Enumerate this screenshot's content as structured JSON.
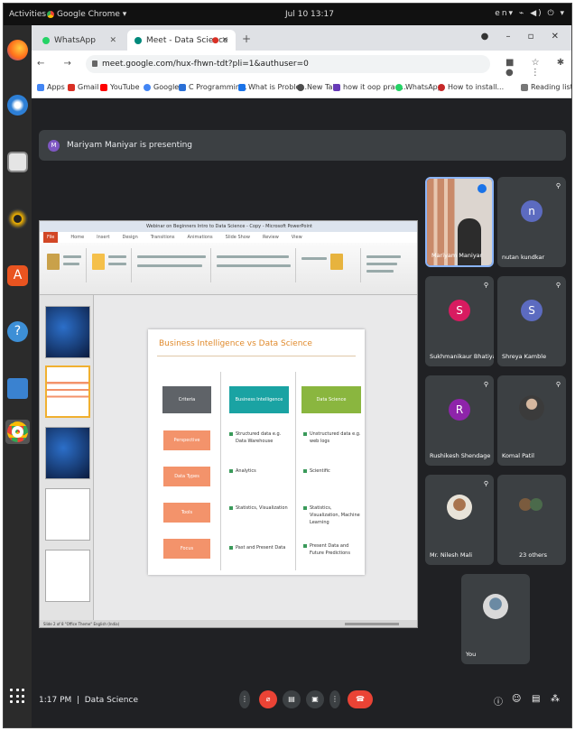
{
  "os": {
    "activities": "Activities",
    "app_name": "Google Chrome ▾",
    "clock": "Jul 10 13:17",
    "status_icons": "en▾  ⌁ ◀) ⏻ ▾"
  },
  "chrome": {
    "tabs": [
      {
        "label": "WhatsApp",
        "favicon_color": "#25d366"
      },
      {
        "label": "Meet - Data Science",
        "favicon_color": "#00897b"
      }
    ],
    "url": "meet.google.com/hux-fhwn-tdt?pli=1&authuser=0",
    "bookmarks": [
      {
        "label": "Apps",
        "color": "#4285f4"
      },
      {
        "label": "Gmail",
        "color": "#d93025"
      },
      {
        "label": "YouTube",
        "color": "#ff0000"
      },
      {
        "label": "Google",
        "color": "#4285f4"
      },
      {
        "label": "C Programmin...",
        "color": "#2a6fd6"
      },
      {
        "label": "What is Proble...",
        "color": "#1a73e8"
      },
      {
        "label": "New Tab",
        "color": "#4d4d4d"
      },
      {
        "label": "how it oop prac...",
        "color": "#673ab7"
      },
      {
        "label": "WhatsApp",
        "color": "#25d366"
      },
      {
        "label": "How to install...",
        "color": "#c62828"
      }
    ],
    "reading_list": "Reading list"
  },
  "meet": {
    "presenting_text": "Mariyam Maniyar is presenting",
    "presenting_avatar": "M",
    "meeting_time": "1:17 PM",
    "meeting_name": "Data Science",
    "participants": [
      {
        "name": "Mariyam Maniyar",
        "type": "video"
      },
      {
        "name": "nutan kundkar",
        "initial": "n",
        "color": "#5c6bc0"
      },
      {
        "name": "Sukhmanikaur Bhatiya",
        "initial": "S",
        "color": "#d81b60"
      },
      {
        "name": "Shreya Kamble",
        "initial": "S",
        "color": "#5c6bc0"
      },
      {
        "name": "Rushikesh Shendage",
        "initial": "R",
        "color": "#8e24aa"
      },
      {
        "name": "Komal Patil",
        "type": "photo"
      },
      {
        "name": "Mr. Nilesh Mali",
        "type": "photo"
      },
      {
        "name": "23 others",
        "type": "others"
      },
      {
        "name": "You",
        "type": "photo"
      }
    ]
  },
  "presentation": {
    "window_title": "Webinar on Beginners Intro to Data Science - Copy - Microsoft PowerPoint",
    "ribbon_tabs": [
      "File",
      "Home",
      "Insert",
      "Design",
      "Transitions",
      "Animations",
      "Slide Show",
      "Review",
      "View"
    ],
    "status_text": "Slide 2 of 8    \"Office Theme\"    English (India)",
    "slide": {
      "title": "Business Intelligence vs Data Science",
      "headers": [
        "Criteria",
        "Business Intelligence",
        "Data Science"
      ],
      "header_colors": [
        "#5f6368",
        "#1aa3a3",
        "#8ab63f"
      ],
      "criteria": [
        "Perspective",
        "Data Types",
        "Tools",
        "Focus"
      ],
      "bi": [
        "Structured data e.g. Data Warehouse",
        "Analytics",
        "Statistics, Visualization",
        "Past and Present Data"
      ],
      "ds": [
        "Unstructured data e.g. web logs",
        "Scientific",
        "Statistics, Visualization, Machine Learning",
        "Present Data and Future Predictions"
      ]
    }
  }
}
